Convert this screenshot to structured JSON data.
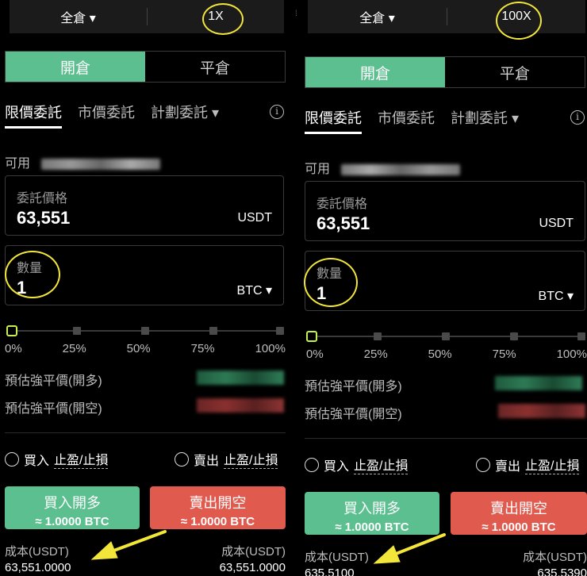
{
  "colors": {
    "accent_green": "#5cbf8f",
    "sell_red": "#e05a4e",
    "knob_lime": "#c6f04e",
    "annotation_yellow": "#f2e63a"
  },
  "panels": [
    {
      "margin_mode": "全倉 ▾",
      "leverage": "1X",
      "position_tabs": {
        "open": "開倉",
        "close": "平倉"
      },
      "order_tabs": [
        "限價委託",
        "市價委託",
        "計劃委託 ▾"
      ],
      "available_label": "可用",
      "price_field": {
        "label": "委託價格",
        "value": "63,551",
        "unit": "USDT"
      },
      "qty_field": {
        "label": "數量",
        "value": "1",
        "unit": "BTC ▾"
      },
      "slider": {
        "fill_percent": 0,
        "ticks": [
          "0%",
          "25%",
          "50%",
          "75%",
          "100%"
        ]
      },
      "liq_long_label": "預估強平價(開多)",
      "liq_short_label": "預估強平價(開空)",
      "tpsl_buy": {
        "prefix": "買入",
        "link": "止盈/止損"
      },
      "tpsl_sell": {
        "prefix": "賣出",
        "link": "止盈/止損"
      },
      "buy_button": {
        "label": "買入開多",
        "amount": "≈ 1.0000 BTC"
      },
      "sell_button": {
        "label": "賣出開空",
        "amount": "≈ 1.0000 BTC"
      },
      "cost_buy": {
        "label": "成本(USDT)",
        "value": "63,551.0000"
      },
      "cost_sell": {
        "label": "成本(USDT)",
        "value": "63,551.0000"
      }
    },
    {
      "margin_mode": "全倉 ▾",
      "leverage": "100X",
      "position_tabs": {
        "open": "開倉",
        "close": "平倉"
      },
      "order_tabs": [
        "限價委託",
        "市價委託",
        "計劃委託 ▾"
      ],
      "available_label": "可用",
      "price_field": {
        "label": "委託價格",
        "value": "63,551",
        "unit": "USDT"
      },
      "qty_field": {
        "label": "數量",
        "value": "1",
        "unit": "BTC ▾"
      },
      "slider": {
        "fill_percent": 0,
        "ticks": [
          "0%",
          "25%",
          "50%",
          "75%",
          "100%"
        ]
      },
      "liq_long_label": "預估強平價(開多)",
      "liq_short_label": "預估強平價(開空)",
      "tpsl_buy": {
        "prefix": "買入",
        "link": "止盈/止損"
      },
      "tpsl_sell": {
        "prefix": "賣出",
        "link": "止盈/止損"
      },
      "buy_button": {
        "label": "買入開多",
        "amount": "≈ 1.0000 BTC"
      },
      "sell_button": {
        "label": "賣出開空",
        "amount": "≈ 1.0000 BTC"
      },
      "cost_buy": {
        "label": "成本(USDT)",
        "value": "635.5100"
      },
      "cost_sell": {
        "label": "成本(USDT)",
        "value": "635.5390"
      }
    }
  ]
}
